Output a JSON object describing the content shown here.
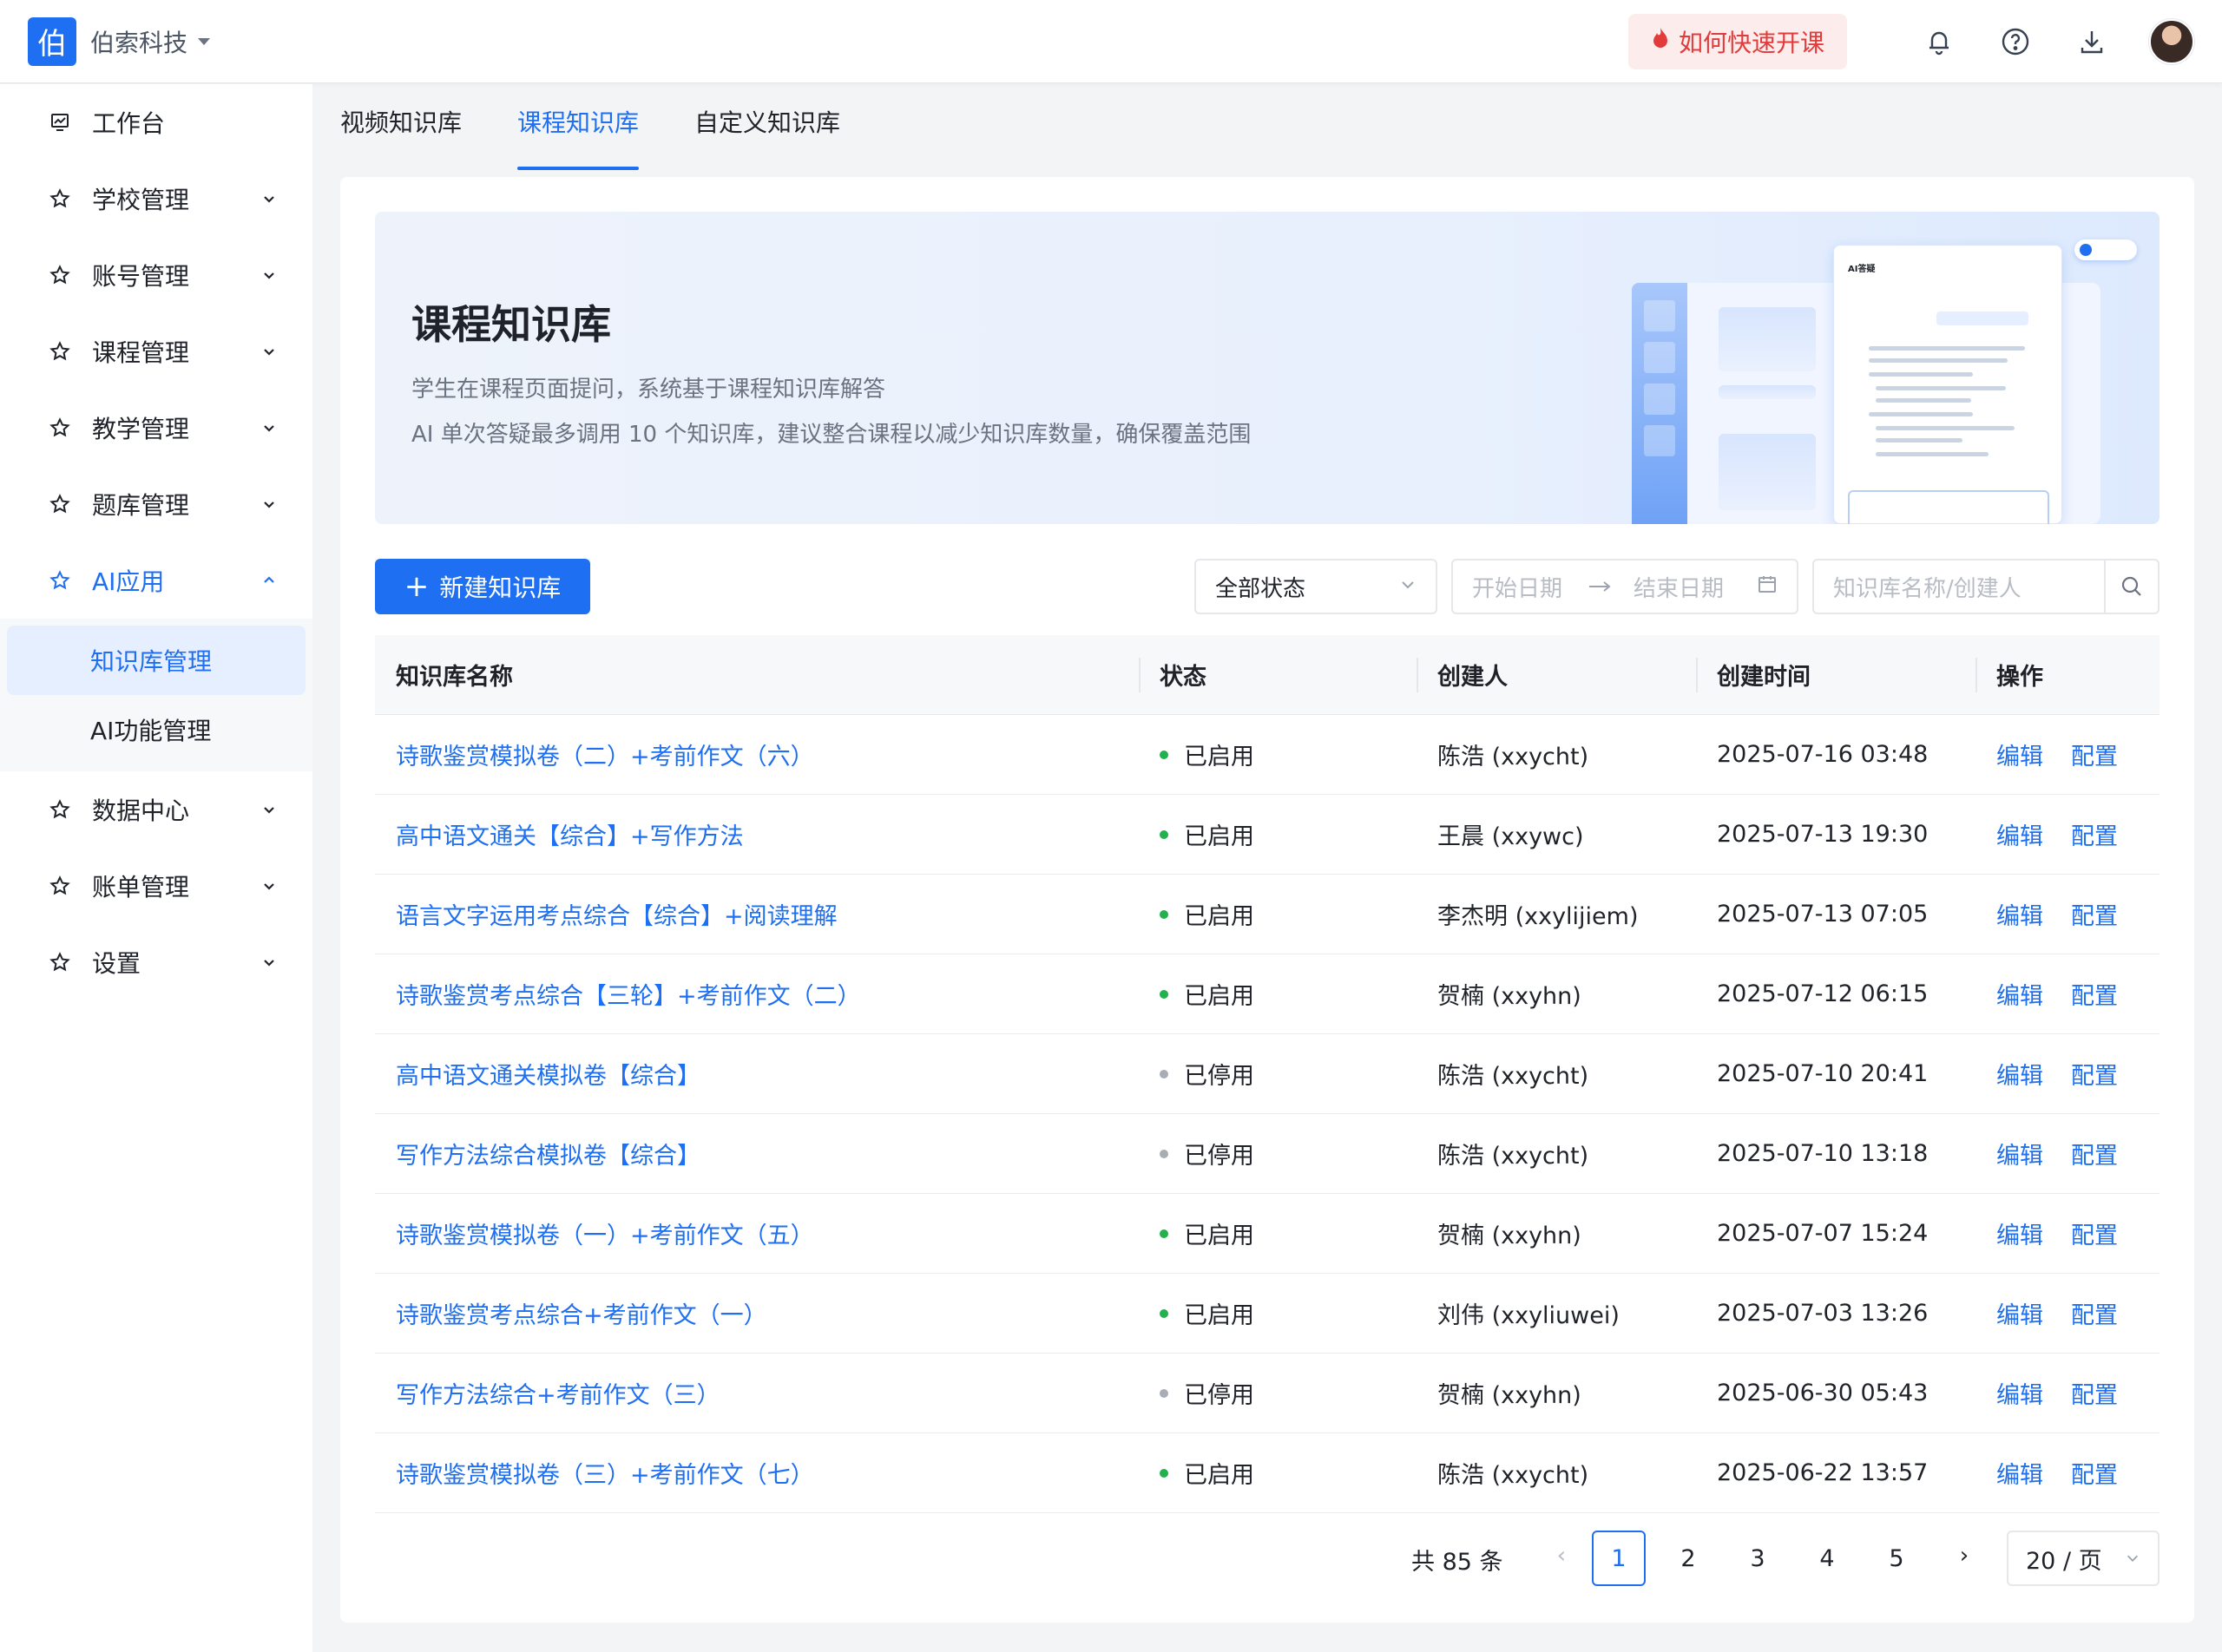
{
  "header": {
    "logo_char": "伯",
    "org_name": "伯索科技",
    "quick_start": "如何快速开课",
    "icons": [
      "bell-icon",
      "help-icon",
      "download-icon"
    ]
  },
  "sidebar": {
    "items": [
      {
        "label": "工作台",
        "icon": "dashboard-icon"
      },
      {
        "label": "学校管理",
        "icon": "star-icon"
      },
      {
        "label": "账号管理",
        "icon": "star-icon"
      },
      {
        "label": "课程管理",
        "icon": "star-icon"
      },
      {
        "label": "教学管理",
        "icon": "star-icon"
      },
      {
        "label": "题库管理",
        "icon": "star-icon"
      },
      {
        "label": "AI应用",
        "icon": "star-icon"
      },
      {
        "label": "数据中心",
        "icon": "star-icon"
      },
      {
        "label": "账单管理",
        "icon": "star-icon"
      },
      {
        "label": "设置",
        "icon": "star-icon"
      }
    ],
    "ai_sub": [
      "知识库管理",
      "AI功能管理"
    ]
  },
  "tabs": [
    "视频知识库",
    "课程知识库",
    "自定义知识库"
  ],
  "banner": {
    "title": "课程知识库",
    "desc1": "学生在课程页面提问，系统基于课程知识库解答",
    "desc2": "AI 单次答疑最多调用 10 个知识库，建议整合课程以减少知识库数量，确保覆盖范围",
    "chat_title": "AI答疑"
  },
  "toolbar": {
    "new_label": "新建知识库",
    "status_value": "全部状态",
    "start_placeholder": "开始日期",
    "end_placeholder": "结束日期",
    "search_placeholder": "知识库名称/创建人"
  },
  "table": {
    "headers": [
      "知识库名称",
      "状态",
      "创建人",
      "创建时间",
      "操作"
    ],
    "rows": [
      {
        "name": "诗歌鉴赏模拟卷（二）+考前作文（六）",
        "status": "已启用",
        "enabled": true,
        "creator": "陈浩 (xxycht)",
        "time": "2025-07-16 03:48"
      },
      {
        "name": "高中语文通关【综合】+写作方法",
        "status": "已启用",
        "enabled": true,
        "creator": "王晨 (xxywc)",
        "time": "2025-07-13 19:30"
      },
      {
        "name": "语言文字运用考点综合【综合】+阅读理解",
        "status": "已启用",
        "enabled": true,
        "creator": "李杰明 (xxylijiem)",
        "time": "2025-07-13 07:05"
      },
      {
        "name": "诗歌鉴赏考点综合【三轮】+考前作文（二）",
        "status": "已启用",
        "enabled": true,
        "creator": "贺楠 (xxyhn)",
        "time": "2025-07-12 06:15"
      },
      {
        "name": "高中语文通关模拟卷【综合】",
        "status": "已停用",
        "enabled": false,
        "creator": "陈浩 (xxycht)",
        "time": "2025-07-10 20:41"
      },
      {
        "name": "写作方法综合模拟卷【综合】",
        "status": "已停用",
        "enabled": false,
        "creator": "陈浩 (xxycht)",
        "time": "2025-07-10 13:18"
      },
      {
        "name": "诗歌鉴赏模拟卷（一）+考前作文（五）",
        "status": "已启用",
        "enabled": true,
        "creator": "贺楠 (xxyhn)",
        "time": "2025-07-07 15:24"
      },
      {
        "name": "诗歌鉴赏考点综合+考前作文（一）",
        "status": "已启用",
        "enabled": true,
        "creator": "刘伟 (xxyliuwei)",
        "time": "2025-07-03 13:26"
      },
      {
        "name": "写作方法综合+考前作文（三）",
        "status": "已停用",
        "enabled": false,
        "creator": "贺楠 (xxyhn)",
        "time": "2025-06-30 05:43"
      },
      {
        "name": "诗歌鉴赏模拟卷（三）+考前作文（七）",
        "status": "已启用",
        "enabled": true,
        "creator": "陈浩 (xxycht)",
        "time": "2025-06-22 13:57"
      }
    ],
    "actions": [
      "编辑",
      "配置"
    ]
  },
  "pagination": {
    "total": "共 85 条",
    "pages": [
      "1",
      "2",
      "3",
      "4",
      "5"
    ],
    "current": "1",
    "page_size": "20 / 页"
  },
  "colors": {
    "primary": "#1e6ff1",
    "enabled": "#22b14c",
    "disabled": "#a8adb5",
    "quick_bg": "#fdecec",
    "quick_text": "#e23b3b"
  }
}
